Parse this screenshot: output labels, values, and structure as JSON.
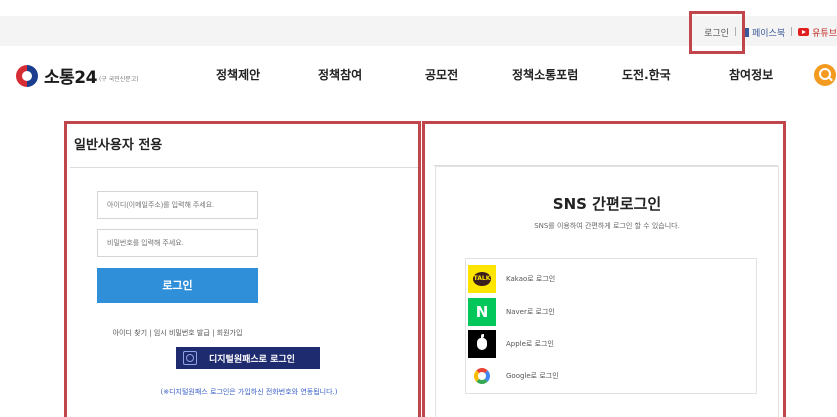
{
  "top_links": {
    "login": "로그인",
    "sep1": "|",
    "facebook": "페이스북",
    "sep2": "|",
    "youtube": "유튜브"
  },
  "logo": {
    "name": "소통24",
    "sub": "(구 국민신문고)"
  },
  "nav": [
    "정책제안",
    "정책참여",
    "공모전",
    "정책소통포럼",
    "도전.한국",
    "참여정보"
  ],
  "login_panel": {
    "title": "일반사용자 전용",
    "id_placeholder": "아이디(이메일주소)를 입력해 주세요.",
    "pw_placeholder": "비밀번호를 입력해 주세요.",
    "login_button": "로그인",
    "links": [
      "아이디 찾기",
      "임시 비밀번호 발급",
      "회원가입"
    ],
    "link_sep": "|",
    "digital_button": "디지털원패스로 로그인",
    "note": "(※디지털원패스 로그인은 가입하신 전화번호와 연동됩니다.)"
  },
  "sns_panel": {
    "title": "SNS 간편로그인",
    "subtitle": "SNS를 이용하여 간편하게 로그인 할 수 있습니다.",
    "items": [
      {
        "icon": "kakao-icon",
        "icon_text": "TALK",
        "label": "Kakao로 로그인"
      },
      {
        "icon": "naver-icon",
        "icon_text": "N",
        "label": "Naver로 로그인"
      },
      {
        "icon": "apple-icon",
        "icon_text": "",
        "label": "Apple로 로그인"
      },
      {
        "icon": "google-icon",
        "icon_text": "",
        "label": "Google로 로그인"
      }
    ]
  },
  "colors": {
    "highlight": "#c0464b",
    "login_button": "#2f8fd8",
    "digital_button": "#1e2b6f",
    "search": "#f39a21",
    "note": "#3a5fc8"
  }
}
